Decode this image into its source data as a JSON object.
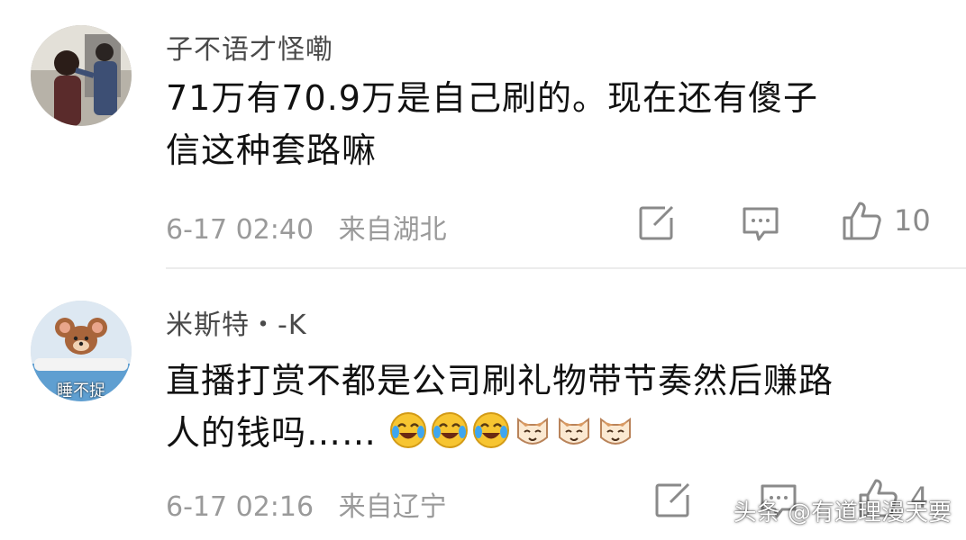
{
  "comments": [
    {
      "username": "子不语才怪嘞",
      "text_line1": "71万有70.9万是自己刷的。现在还有傻子",
      "text_line2": "信这种套路嘛",
      "time": "6-17 02:40",
      "location": "来自湖北",
      "likes": "10"
    },
    {
      "username": "米斯特・-K",
      "text_line1": "直播打赏不都是公司刷礼物带节奏然后赚路",
      "text_line2": "人的钱吗……",
      "avatar_caption": "睡不捉",
      "emojis": [
        "laugh-cry-icon",
        "laugh-cry-icon",
        "laugh-cry-icon",
        "cat-face-icon",
        "cat-face-icon",
        "cat-face-icon"
      ],
      "time": "6-17 02:16",
      "location": "来自辽宁",
      "likes": "4"
    }
  ],
  "watermark": "头条 @有道理漫天要",
  "colors": {
    "meta": "#9a9a9a",
    "username": "#4a4a4a",
    "divider": "#ececec"
  }
}
